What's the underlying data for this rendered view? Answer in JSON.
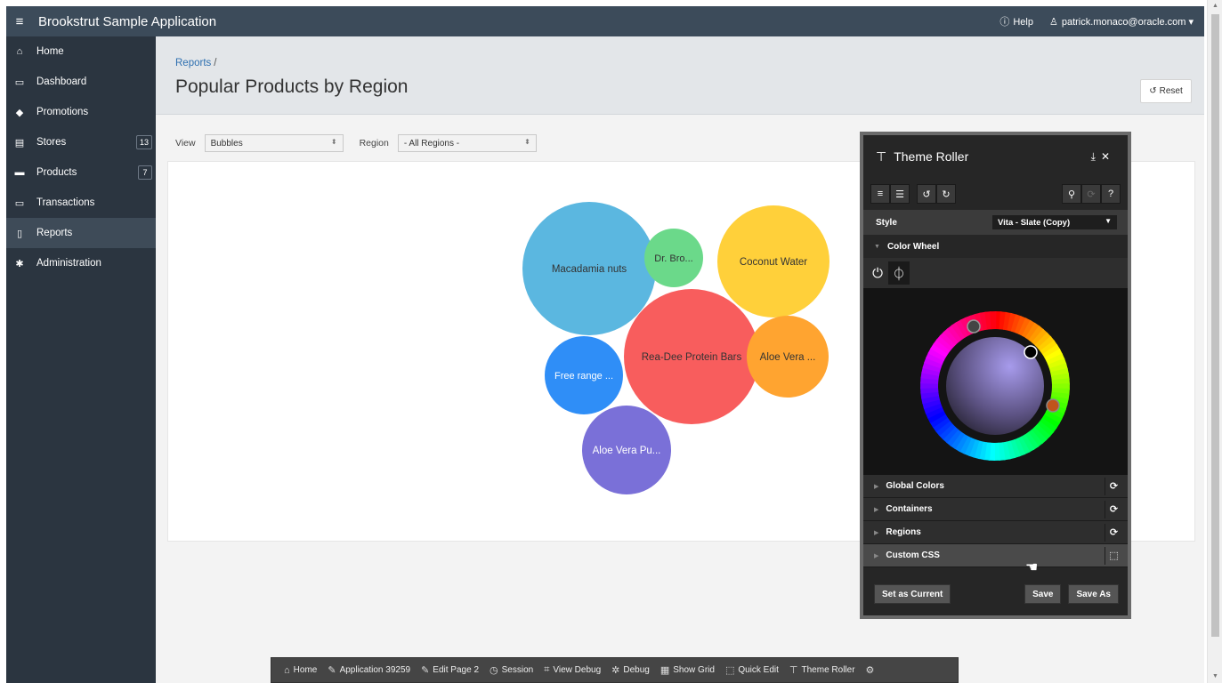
{
  "header": {
    "title": "Brookstrut Sample Application",
    "help": "Help",
    "user": "patrick.monaco@oracle.com"
  },
  "sidebar": {
    "items": [
      {
        "label": "Home",
        "icon": "home-icon"
      },
      {
        "label": "Dashboard",
        "icon": "monitor-icon"
      },
      {
        "label": "Promotions",
        "icon": "tag-icon"
      },
      {
        "label": "Stores",
        "icon": "building-icon",
        "badge": "13"
      },
      {
        "label": "Products",
        "icon": "box-icon",
        "badge": "7"
      },
      {
        "label": "Transactions",
        "icon": "card-icon"
      },
      {
        "label": "Reports",
        "icon": "file-icon",
        "active": true
      },
      {
        "label": "Administration",
        "icon": "gear-icon"
      }
    ]
  },
  "page": {
    "breadcrumb": "Reports",
    "breadcrumb_sep": "/",
    "title": "Popular Products by Region",
    "reset": "Reset"
  },
  "filters": {
    "view_label": "View",
    "view_value": "Bubbles",
    "region_label": "Region",
    "region_value": "- All Regions -"
  },
  "chart_data": {
    "type": "bubble",
    "bubbles": [
      {
        "label": "Macadamia nuts",
        "color": "#5bb7e0"
      },
      {
        "label": "Dr. Bro...",
        "color": "#6bd98a"
      },
      {
        "label": "Coconut Water",
        "color": "#ffd03a"
      },
      {
        "label": "Rea-Dee Protein Bars",
        "color": "#f85d5d"
      },
      {
        "label": "Aloe Vera ...",
        "color": "#ffa430"
      },
      {
        "label": "Free range ...",
        "color": "#2f8ef7"
      },
      {
        "label": "Aloe Vera Pu...",
        "color": "#7a70d8"
      }
    ]
  },
  "theme_roller": {
    "title": "Theme Roller",
    "style_label": "Style",
    "style_value": "Vita - Slate (Copy)",
    "color_wheel": "Color Wheel",
    "sections": [
      "Global Colors",
      "Containers",
      "Regions",
      "Custom CSS"
    ],
    "set_current": "Set as Current",
    "save": "Save",
    "save_as": "Save As"
  },
  "devbar": {
    "items": [
      {
        "label": "Home",
        "icon": "home-icon"
      },
      {
        "label": "Application 39259",
        "icon": "edit-icon"
      },
      {
        "label": "Edit Page 2",
        "icon": "edit-icon"
      },
      {
        "label": "Session",
        "icon": "clock-icon"
      },
      {
        "label": "View Debug",
        "icon": "debug-view-icon"
      },
      {
        "label": "Debug",
        "icon": "bug-icon"
      },
      {
        "label": "Show Grid",
        "icon": "grid-icon"
      },
      {
        "label": "Quick Edit",
        "icon": "quick-edit-icon"
      },
      {
        "label": "Theme Roller",
        "icon": "paint-roller-icon"
      }
    ]
  }
}
